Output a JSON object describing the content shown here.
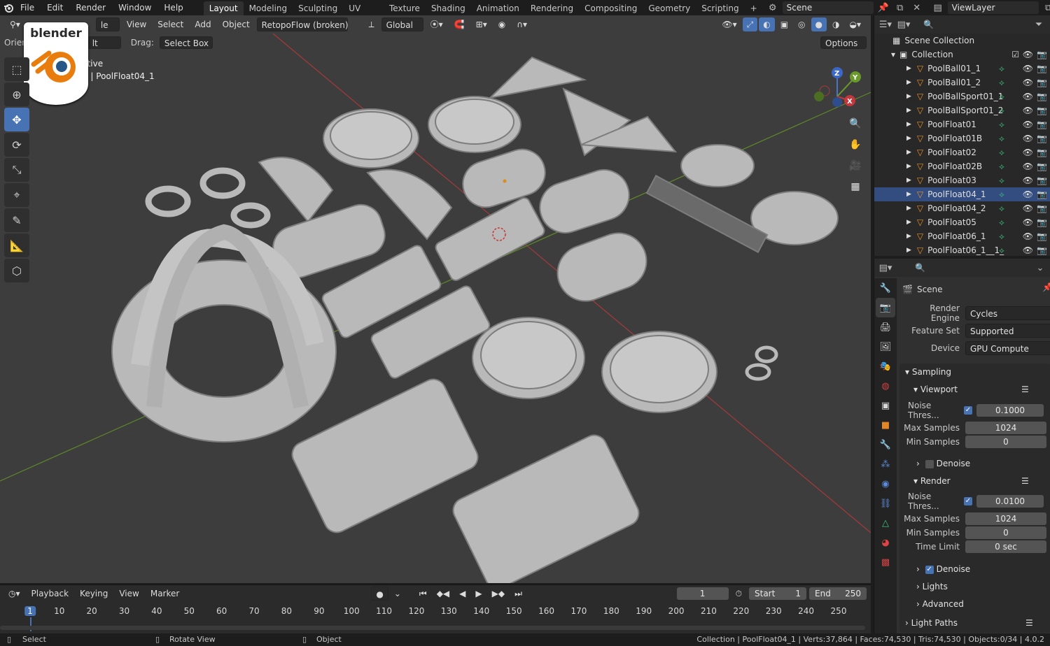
{
  "topbar": {
    "menu": [
      "File",
      "Edit",
      "Render",
      "Window",
      "Help"
    ],
    "workspaces": [
      "Layout",
      "Modeling",
      "Sculpting",
      "UV Editing",
      "Texture Paint",
      "Shading",
      "Animation",
      "Rendering",
      "Compositing",
      "Geometry Nodes",
      "Scripting"
    ],
    "active_workspace": "Layout",
    "add_tab": "+",
    "scene_name": "Scene",
    "view_layer": "ViewLayer"
  },
  "viewport": {
    "header": {
      "mode": "le",
      "view": "View",
      "select": "Select",
      "add": "Add",
      "object": "Object",
      "addon_menu": "RetopoFlow (broken)",
      "orientation": "Global"
    },
    "tool_settings": {
      "orient_label": "Orien",
      "default_value": "lt",
      "drag_label": "Drag:",
      "drag_value": "Select Box",
      "options": "Options"
    },
    "overlay_text": {
      "line1": "ctive",
      "line2": "n | PoolFloat04_1"
    },
    "gizmo": {
      "z": "Z",
      "y": "Y",
      "x": "X"
    },
    "logo_text": "blender",
    "colors": {
      "bg": "#3d3d3d",
      "x_axis": "#b0363b",
      "y_axis": "#6a9a2a"
    }
  },
  "outliner": {
    "search_placeholder": "",
    "scene_collection": "Scene Collection",
    "collection": "Collection",
    "items": [
      {
        "name": "PoolBall01_1",
        "selected": false
      },
      {
        "name": "PoolBall01_2",
        "selected": false
      },
      {
        "name": "PoolBallSport01_1",
        "selected": false
      },
      {
        "name": "PoolBallSport01_2",
        "selected": false
      },
      {
        "name": "PoolFloat01",
        "selected": false
      },
      {
        "name": "PoolFloat01B",
        "selected": false
      },
      {
        "name": "PoolFloat02",
        "selected": false
      },
      {
        "name": "PoolFloat02B",
        "selected": false
      },
      {
        "name": "PoolFloat03",
        "selected": false
      },
      {
        "name": "PoolFloat04_1",
        "selected": true
      },
      {
        "name": "PoolFloat04_2",
        "selected": false
      },
      {
        "name": "PoolFloat05",
        "selected": false
      },
      {
        "name": "PoolFloat06_1",
        "selected": false
      },
      {
        "name": "PoolFloat06_1__1_",
        "selected": false
      }
    ]
  },
  "properties": {
    "scene_label": "Scene",
    "render_engine_label": "Render Engine",
    "render_engine": "Cycles",
    "feature_set_label": "Feature Set",
    "feature_set": "Supported",
    "device_label": "Device",
    "device": "GPU Compute",
    "sampling": "Sampling",
    "viewport": "Viewport",
    "vp_noise_label": "Noise Thres...",
    "vp_noise": "0.1000",
    "vp_max_label": "Max Samples",
    "vp_max": "1024",
    "vp_min_label": "Min Samples",
    "vp_min": "0",
    "vp_denoise": "Denoise",
    "render": "Render",
    "r_noise_label": "Noise Thres...",
    "r_noise": "0.0100",
    "r_max_label": "Max Samples",
    "r_max": "1024",
    "r_min_label": "Min Samples",
    "r_min": "0",
    "time_limit_label": "Time Limit",
    "time_limit": "0 sec",
    "r_denoise": "Denoise",
    "lights": "Lights",
    "advanced": "Advanced",
    "light_paths": "Light Paths"
  },
  "timeline": {
    "playback": "Playback",
    "keying": "Keying",
    "view": "View",
    "marker": "Marker",
    "current_frame": "1",
    "start_label": "Start",
    "start": "1",
    "end_label": "End",
    "end": "250",
    "ticks": [
      "1",
      "10",
      "20",
      "30",
      "40",
      "50",
      "60",
      "70",
      "80",
      "90",
      "100",
      "110",
      "120",
      "130",
      "140",
      "150",
      "160",
      "170",
      "180",
      "190",
      "200",
      "210",
      "220",
      "230",
      "240",
      "250"
    ]
  },
  "statusbar": {
    "select": "Select",
    "rotate": "Rotate View",
    "object": "Object",
    "stats": "Collection | PoolFloat04_1 | Verts:37,864 | Faces:74,530 | Tris:74,530 | Objects:0/34 | 4.0.2"
  }
}
